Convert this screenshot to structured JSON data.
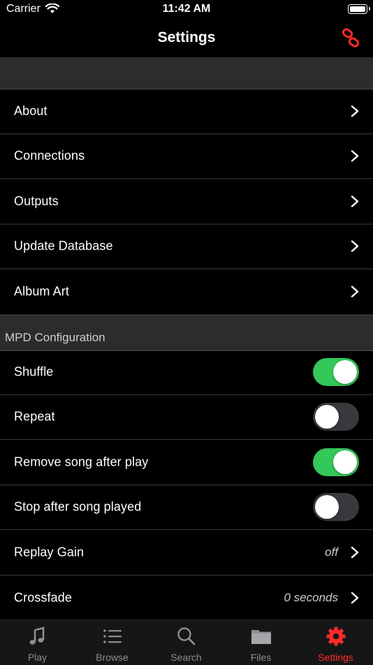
{
  "status": {
    "carrier": "Carrier",
    "time": "11:42 AM"
  },
  "nav": {
    "title": "Settings",
    "action_icon": "link-icon"
  },
  "colors": {
    "accent": "#ff2a2a",
    "toggle_on": "#34c759",
    "toggle_off": "#39393d",
    "section_bg": "#2c2c2e"
  },
  "general": {
    "items": [
      {
        "label": "About"
      },
      {
        "label": "Connections"
      },
      {
        "label": "Outputs"
      },
      {
        "label": "Update Database"
      },
      {
        "label": "Album Art"
      }
    ]
  },
  "mpd": {
    "header": "MPD Configuration",
    "items": [
      {
        "label": "Shuffle",
        "type": "toggle",
        "on": true
      },
      {
        "label": "Repeat",
        "type": "toggle",
        "on": false
      },
      {
        "label": "Remove song after play",
        "type": "toggle",
        "on": true
      },
      {
        "label": "Stop after song played",
        "type": "toggle",
        "on": false
      },
      {
        "label": "Replay Gain",
        "type": "value",
        "value": "off"
      },
      {
        "label": "Crossfade",
        "type": "value",
        "value": "0 seconds"
      }
    ]
  },
  "tabs": [
    {
      "label": "Play",
      "icon": "music-note-icon",
      "active": false
    },
    {
      "label": "Browse",
      "icon": "list-icon",
      "active": false
    },
    {
      "label": "Search",
      "icon": "search-icon",
      "active": false
    },
    {
      "label": "Files",
      "icon": "folder-icon",
      "active": false
    },
    {
      "label": "Settings",
      "icon": "gear-icon",
      "active": true
    }
  ]
}
